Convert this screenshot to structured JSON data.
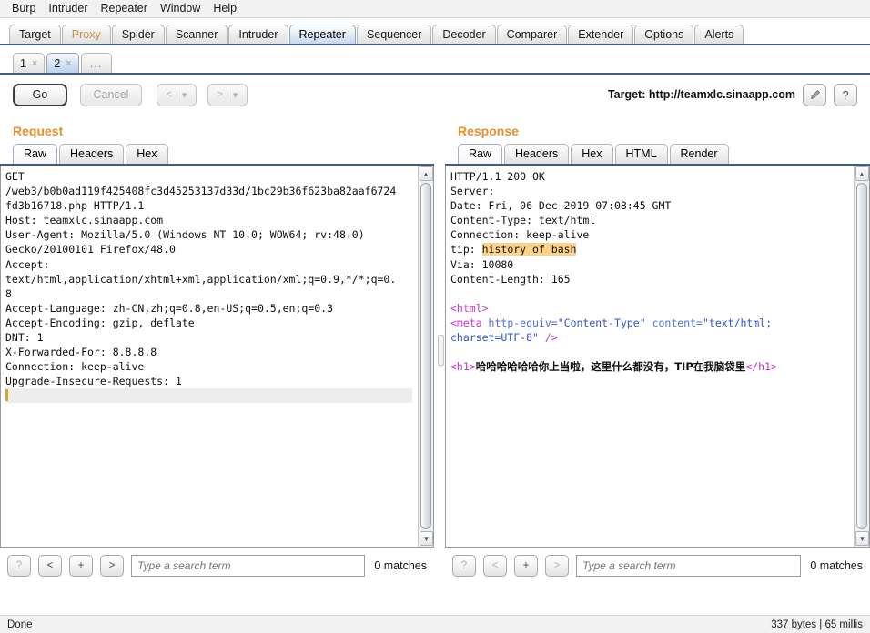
{
  "menu": {
    "items": [
      "Burp",
      "Intruder",
      "Repeater",
      "Window",
      "Help"
    ]
  },
  "main_tabs": [
    {
      "label": "Target",
      "state": "normal"
    },
    {
      "label": "Proxy",
      "state": "muted"
    },
    {
      "label": "Spider",
      "state": "normal"
    },
    {
      "label": "Scanner",
      "state": "normal"
    },
    {
      "label": "Intruder",
      "state": "normal"
    },
    {
      "label": "Repeater",
      "state": "selected"
    },
    {
      "label": "Sequencer",
      "state": "normal"
    },
    {
      "label": "Decoder",
      "state": "normal"
    },
    {
      "label": "Comparer",
      "state": "normal"
    },
    {
      "label": "Extender",
      "state": "normal"
    },
    {
      "label": "Options",
      "state": "normal"
    },
    {
      "label": "Alerts",
      "state": "normal"
    }
  ],
  "repeater_tabs": [
    {
      "label": "1",
      "close": "×",
      "selected": false
    },
    {
      "label": "2",
      "close": "×",
      "selected": true
    }
  ],
  "repeater_more": "...",
  "toolbar": {
    "go_label": "Go",
    "cancel_label": "Cancel",
    "back_label": "<",
    "back_caret": "▾",
    "forward_label": ">",
    "forward_caret": "▾",
    "separator": "|",
    "target_label": "Target: http://teamxlc.sinaapp.com",
    "edit_icon": "pencil-icon",
    "help_label": "?"
  },
  "request": {
    "title": "Request",
    "tabs": [
      {
        "label": "Raw",
        "selected": true
      },
      {
        "label": "Headers",
        "selected": false
      },
      {
        "label": "Hex",
        "selected": false
      }
    ],
    "body": "GET\n/web3/b0b0ad119f425408fc3d45253137d33d/1bc29b36f623ba82aaf6724\nfd3b16718.php HTTP/1.1\nHost: teamxlc.sinaapp.com\nUser-Agent: Mozilla/5.0 (Windows NT 10.0; WOW64; rv:48.0)\nGecko/20100101 Firefox/48.0\nAccept:\ntext/html,application/xhtml+xml,application/xml;q=0.9,*/*;q=0.\n8\nAccept-Language: zh-CN,zh;q=0.8,en-US;q=0.5,en;q=0.3\nAccept-Encoding: gzip, deflate\nDNT: 1\nX-Forwarded-For: 8.8.8.8\nConnection: keep-alive\nUpgrade-Insecure-Requests: 1",
    "search": {
      "help_label": "?",
      "prev_label": "<",
      "add_label": "+",
      "next_label": ">",
      "placeholder": "Type a search term",
      "value": "",
      "matches": "0 matches"
    }
  },
  "response": {
    "title": "Response",
    "tabs": [
      {
        "label": "Raw",
        "selected": true
      },
      {
        "label": "Headers",
        "selected": false
      },
      {
        "label": "Hex",
        "selected": false
      },
      {
        "label": "HTML",
        "selected": false
      },
      {
        "label": "Render",
        "selected": false
      }
    ],
    "headers": [
      {
        "text": "HTTP/1.1 200 OK"
      },
      {
        "text": "Server:"
      },
      {
        "text": "Date: Fri, 06 Dec 2019 07:08:45 GMT"
      },
      {
        "text": "Content-Type: text/html"
      },
      {
        "text": "Connection: keep-alive"
      },
      {
        "text": "tip: ",
        "highlight": "history of bash"
      },
      {
        "text": "Via: 10080"
      },
      {
        "text": "Content-Length: 165"
      }
    ],
    "html_lines": [
      {
        "tag_open": "<html>"
      },
      {
        "tag_open": "<meta ",
        "attr": "http-equiv=",
        "val": "\"Content-Type\" ",
        "attr2": "content=",
        "val2": "\"text/html;"
      },
      {
        "val3": "charset=UTF-8\" ",
        "tag_close": "/>"
      },
      {
        "h1_open": "<h1>",
        "cjk": "哈哈哈哈哈哈你上当啦，这里什么都没有，TIP在我脑袋里",
        "h1_close": "</h1>"
      }
    ],
    "search": {
      "help_label": "?",
      "prev_label": "<",
      "add_label": "+",
      "next_label": ">",
      "placeholder": "Type a search term",
      "value": "",
      "matches": "0 matches"
    }
  },
  "statusbar": {
    "left": "Done",
    "right": "337 bytes | 65 millis"
  },
  "colors": {
    "accent_orange": "#e8912a",
    "highlight": "#ffd28a",
    "tab_line": "#3f5d8a",
    "tag": "#cc33cc",
    "attr": "#4f6fd0",
    "caret": "#d8a32e"
  }
}
